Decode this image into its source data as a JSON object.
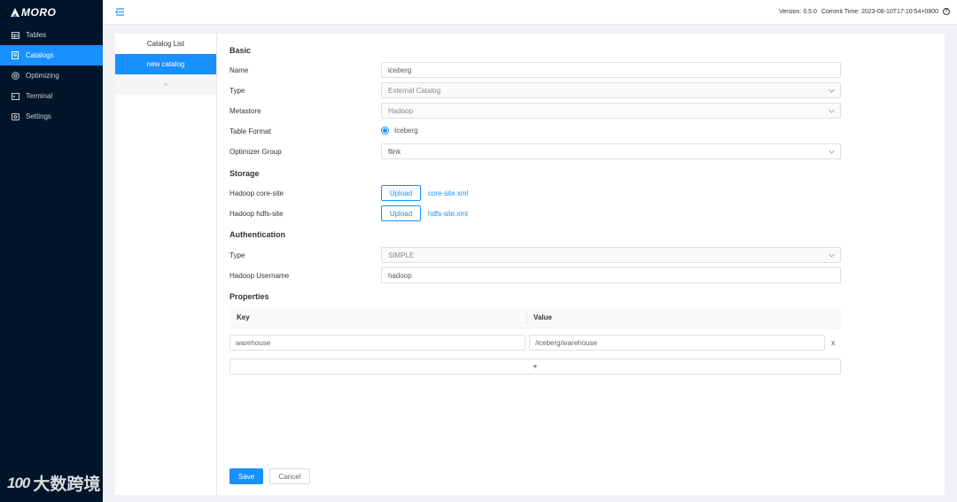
{
  "app": {
    "logo_text": "MORO"
  },
  "header": {
    "version": "Version: 0.5.0",
    "commit": "Commit Time: 2023-08-10T17:10:54+0800"
  },
  "sidebar": {
    "items": [
      {
        "label": "Tables",
        "icon": "table-icon"
      },
      {
        "label": "Catalogs",
        "icon": "catalog-icon",
        "active": true
      },
      {
        "label": "Optimizing",
        "icon": "optimizing-icon"
      },
      {
        "label": "Terminal",
        "icon": "terminal-icon"
      },
      {
        "label": "Settings",
        "icon": "settings-icon"
      }
    ]
  },
  "catalog_list": {
    "title": "Catalog List",
    "items": [
      "new catalog"
    ],
    "add_label": "+"
  },
  "form": {
    "basic": {
      "title": "Basic",
      "name_label": "Name",
      "name_value": "iceberg",
      "type_label": "Type",
      "type_value": "External Catalog",
      "metastore_label": "Metastore",
      "metastore_value": "Hadoop",
      "table_format_label": "Table Format",
      "table_format_value": "Iceberg",
      "optimizer_group_label": "Optimizer Group",
      "optimizer_group_value": "flink"
    },
    "storage": {
      "title": "Storage",
      "core_site_label": "Hadoop core-site",
      "core_site_file": "core-site.xml",
      "hdfs_site_label": "Hadoop hdfs-site",
      "hdfs_site_file": "hdfs-site.xml",
      "upload_label": "Upload"
    },
    "authentication": {
      "title": "Authentication",
      "type_label": "Type",
      "type_value": "SIMPLE",
      "username_label": "Hadoop Username",
      "username_value": "hadoop"
    },
    "properties": {
      "title": "Properties",
      "key_header": "Key",
      "value_header": "Value",
      "rows": [
        {
          "key": "warehouse",
          "value": "/iceberg/warehouse"
        }
      ],
      "remove_label": "x",
      "add_label": "+"
    },
    "save_label": "Save",
    "cancel_label": "Cancel"
  },
  "watermark": {
    "logo": "100",
    "text": "大数跨境"
  },
  "colors": {
    "primary": "#1890ff",
    "sidebar_bg": "#001529"
  }
}
